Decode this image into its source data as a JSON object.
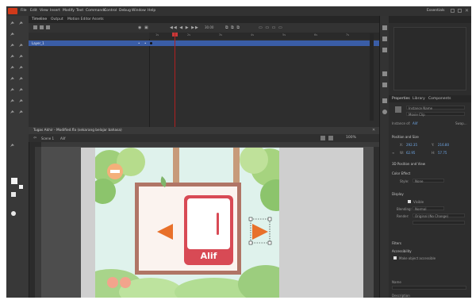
{
  "menubar": {
    "items": [
      "File",
      "Edit",
      "View",
      "Insert",
      "Modify",
      "Text",
      "Commands",
      "Control",
      "Debug",
      "Window",
      "Help"
    ],
    "workspace": "Essentials"
  },
  "timeline": {
    "tabs": [
      "Timeline",
      "Output",
      "Motion Editor",
      "Assets"
    ],
    "layer_name": "Layer_1",
    "fps": "30.00",
    "frame_labels": [
      "1s",
      "2s",
      "3s",
      "4s",
      "5s",
      "6s",
      "7s"
    ]
  },
  "document": {
    "tab_title": "Tugas Akhir - Modified.fla (sekarang belajar bahasa)",
    "scene": "Scene 1",
    "symbol": "Alif",
    "zoom": "100%"
  },
  "stage": {
    "letter": "ا",
    "caption": "Alif"
  },
  "properties": {
    "tabs": [
      "Properties",
      "Library",
      "Components"
    ],
    "instance_name": "Instance Name",
    "symbol_type": "Movie Clip",
    "instance_of": "Instance of:",
    "swap_label": "Swap...",
    "section_position": "Position and Size",
    "x_label": "X:",
    "x_value": "292.35",
    "y_label": "Y:",
    "y_value": "216.80",
    "w_label": "W:",
    "w_value": "62.95",
    "h_label": "H:",
    "h_value": "57.75",
    "section_3d": "3D Position and View",
    "section_color": "Color Effect",
    "color_style": "Style:",
    "color_style_value": "None",
    "section_display": "Display",
    "visible_label": "Visible",
    "blending_label": "Blending:",
    "blending_value": "Normal",
    "render_label": "Render:",
    "render_value": "Original (No Change)",
    "section_filters": "Filters",
    "section_accessibility": "Accessibility",
    "checkbox_label": "Make object accessible",
    "footer_a": "Name",
    "footer_b": "Description"
  },
  "colors": {
    "accent_orange": "#e8702a",
    "frame_red": "#d84a55",
    "board_brown": "#b07566",
    "selection_blue": "#3a5da6",
    "playhead_red": "#b02020"
  }
}
